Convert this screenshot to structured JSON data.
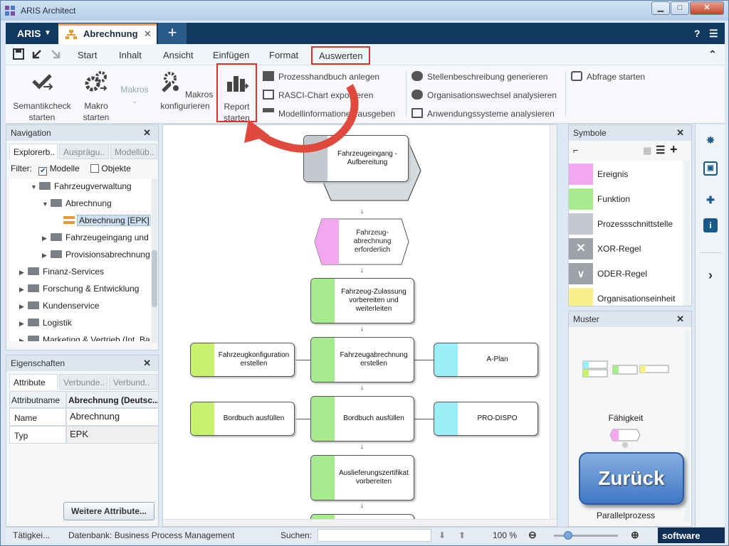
{
  "window": {
    "title": "ARIS Architect",
    "minimize": "▁",
    "maximize": "□",
    "close": "✕"
  },
  "tabbar": {
    "aris_label": "ARIS",
    "aris_dropdown": "▼",
    "doc_tab_label": "Abrechnung",
    "doc_tab_close": "✕",
    "new_tab": "+",
    "help": "?",
    "menu": "☰"
  },
  "menubar": {
    "items": [
      "Start",
      "Inhalt",
      "Ansicht",
      "Einfügen",
      "Format",
      "Auswerten"
    ],
    "collapse": "⌃"
  },
  "ribbon": {
    "semantikcheck": "Semantikcheck starten",
    "makro_starten": "Makro starten",
    "makros": "Makros",
    "makros_konfigurieren": "Makros konfigurieren",
    "report_starten": "Report starten",
    "small_col1": [
      "Prozesshandbuch anlegen",
      "RASCI-Chart exportieren",
      "Modellinformationen ausgeben"
    ],
    "small_col2": [
      "Stellenbeschreibung generieren",
      "Organisationswechsel analysieren",
      "Anwendungssysteme analysieren"
    ],
    "abfrage": "Abfrage starten"
  },
  "navigation": {
    "title": "Navigation",
    "tabs": [
      "Explorerb..",
      "Ausprägu..",
      "Modellüb.."
    ],
    "filter_label": "Filter:",
    "filter_modelle": "Modelle",
    "filter_objekte": "Objekte",
    "tree": [
      {
        "label": "Fahrzeugverwaltung",
        "expanded": true
      },
      {
        "label": "Abrechnung",
        "expanded": true
      },
      {
        "label": "Abrechnung [EPK]",
        "selected": true
      },
      {
        "label": "Fahrzeugeingang und"
      },
      {
        "label": "Provisionsabrechnung"
      },
      {
        "label": "Finanz-Services"
      },
      {
        "label": "Forschung & Entwicklung"
      },
      {
        "label": "Kundenservice"
      },
      {
        "label": "Logistik"
      },
      {
        "label": "Marketing & Vertrieb (Int. Ba"
      }
    ]
  },
  "eigenschaften": {
    "title": "Eigenschaften",
    "tabs": [
      "Attribute",
      "Verbunde..",
      "Verbund.."
    ],
    "header": [
      "Attributname",
      "Abrechnung (Deutsc..."
    ],
    "rows": [
      [
        "Name",
        "Abrechnung"
      ],
      [
        "Typ",
        "EPK"
      ]
    ],
    "more_button": "Weitere Attribute..."
  },
  "diagram": {
    "nodes": [
      "Fahrzeugeingang - Aufbereitung",
      "Fahrzeug-abrechnung erforderlich",
      "Fahrzeug-Zulassung vorbereiten und weiterleiten",
      "Fahrzeugkonfiguration erstellen",
      "Fahrzeugabrechnung erstellen",
      "A-Plan",
      "Bordbuch ausfüllen",
      "Bordbuch ausfüllen",
      "PRO-DISPO",
      "Auslieferungszertifikat vorbereiten"
    ]
  },
  "symbole": {
    "title": "Symbole",
    "items": [
      "Ereignis",
      "Funktion",
      "Prozessschnittstelle",
      "XOR-Regel",
      "ODER-Regel",
      "Organisationseinheit"
    ]
  },
  "muster": {
    "title": "Muster",
    "items": [
      "Fähigkeit",
      "Parallelprozess"
    ]
  },
  "overlay": {
    "zurueck": "Zurück"
  },
  "statusbar": {
    "status": "Tätigkei...",
    "database": "Datenbank: Business Process Management",
    "search_label": "Suchen:",
    "zoom": "100 %",
    "brand": "software"
  },
  "colors": {
    "accent_red": "#d9342b",
    "tab_dark": "#11385e",
    "event": "#f3a7ee",
    "function": "#a6ec8e",
    "interface": "#c4c9cf",
    "org": "#f9f08a",
    "role": "#c6f06d",
    "system": "#9aeef7"
  }
}
